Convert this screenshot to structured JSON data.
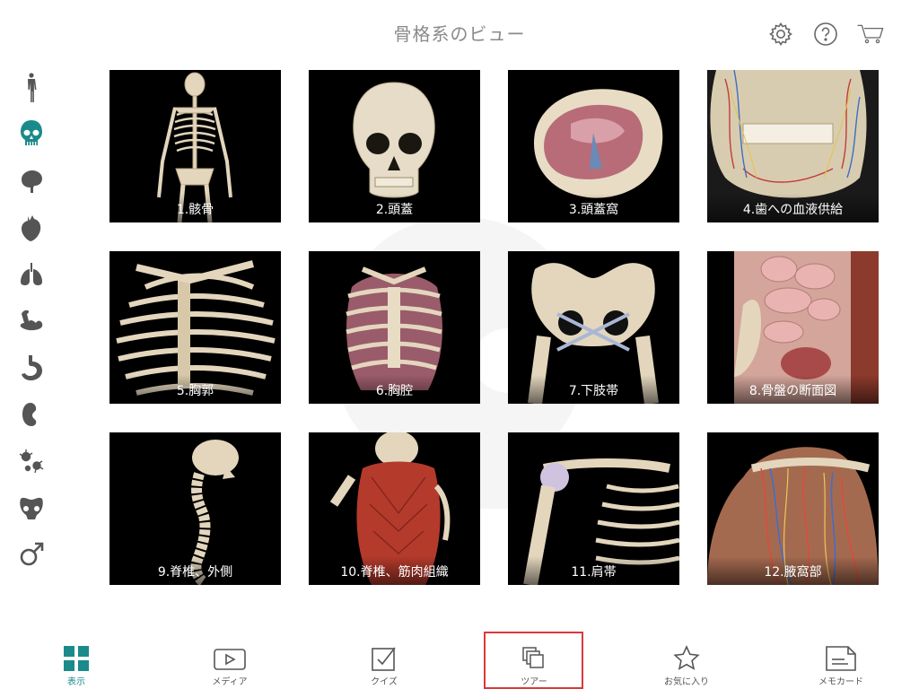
{
  "header": {
    "title": "骨格系のビュー"
  },
  "top_icons": [
    "gear-icon",
    "help-icon",
    "cart-icon"
  ],
  "sidebar": {
    "items": [
      {
        "icon": "body-icon",
        "active": false
      },
      {
        "icon": "skull-icon",
        "active": true
      },
      {
        "icon": "brain-icon",
        "active": false
      },
      {
        "icon": "heart-icon",
        "active": false
      },
      {
        "icon": "lungs-icon",
        "active": false
      },
      {
        "icon": "muscle-arm-icon",
        "active": false
      },
      {
        "icon": "stomach-icon",
        "active": false
      },
      {
        "icon": "kidney-icon",
        "active": false
      },
      {
        "icon": "cells-icon",
        "active": false
      },
      {
        "icon": "pelvis-icon",
        "active": false
      },
      {
        "icon": "male-symbol-icon",
        "active": false
      }
    ]
  },
  "tiles": [
    {
      "label": "1.骸骨"
    },
    {
      "label": "2.頭蓋"
    },
    {
      "label": "3.頭蓋窩"
    },
    {
      "label": "4.歯への血液供給"
    },
    {
      "label": "5.胸郭"
    },
    {
      "label": "6.胸腔"
    },
    {
      "label": "7.下肢帯"
    },
    {
      "label": "8.骨盤の断面図"
    },
    {
      "label": "9.脊椎、外側"
    },
    {
      "label": "10.脊椎、筋肉組織"
    },
    {
      "label": "11.肩帯"
    },
    {
      "label": "12.腋窩部"
    }
  ],
  "tabbar": {
    "tabs": [
      {
        "label": "表示",
        "icon": "grid-icon",
        "active": true
      },
      {
        "label": "メディア",
        "icon": "play-icon",
        "active": false
      },
      {
        "label": "クイズ",
        "icon": "checkbox-icon",
        "active": false
      },
      {
        "label": "ツアー",
        "icon": "copy-stack-icon",
        "active": false
      },
      {
        "label": "お気に入り",
        "icon": "star-icon",
        "active": false
      },
      {
        "label": "メモカード",
        "icon": "note-card-icon",
        "active": false
      }
    ]
  },
  "colors": {
    "accent": "#1b8a8a",
    "highlight": "#d83a3a",
    "tile_bg": "#000000",
    "bone": "#e8dcc4"
  }
}
